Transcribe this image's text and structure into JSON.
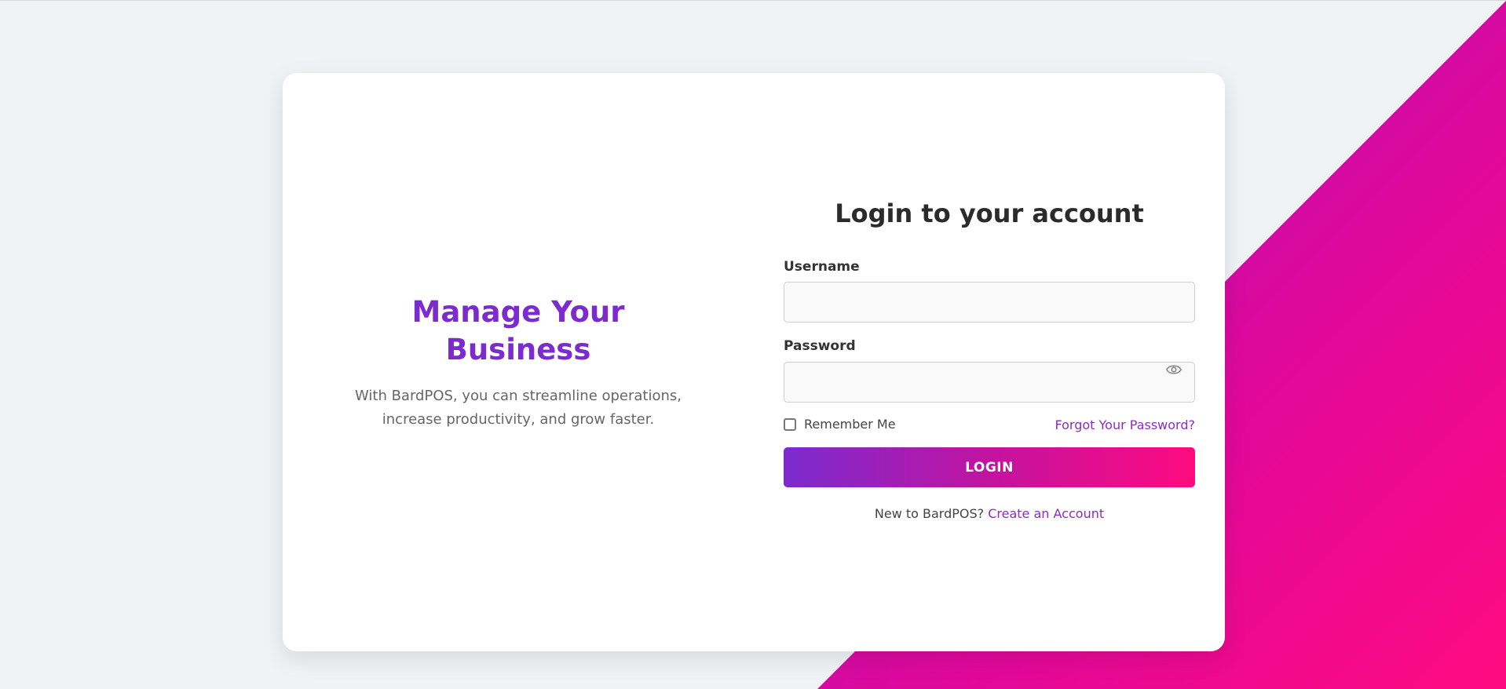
{
  "colors": {
    "background": "#f0f2f5",
    "card": "#ffffff",
    "accent_purple": "#7b2bcf",
    "accent_pink": "#ff0a80",
    "link": "#8a2cc8",
    "heading": "#2b2b2b",
    "body_text": "#666666"
  },
  "hero": {
    "title": "Manage Your Business",
    "description": "With BardPOS, you can streamline operations, increase productivity, and grow faster."
  },
  "login_form": {
    "title": "Login to your account",
    "username_label": "Username",
    "username_value": "",
    "password_label": "Password",
    "password_value": "",
    "password_toggle_icon": "eye-icon",
    "remember_me_label": "Remember Me",
    "remember_me_checked": false,
    "forgot_password_link": "Forgot Your Password?",
    "submit_label": "LOGIN",
    "signup_prompt": "New to BardPOS?",
    "signup_link": "Create an Account"
  }
}
